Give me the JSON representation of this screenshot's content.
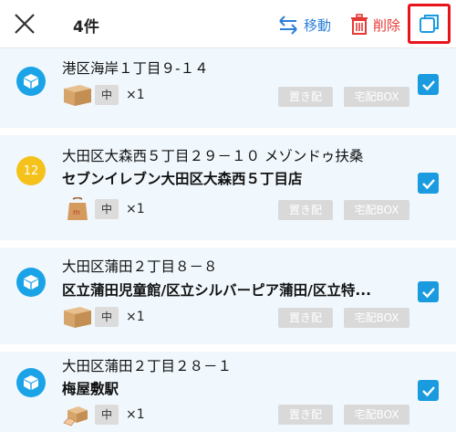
{
  "header": {
    "count_label": "4件",
    "move_label": "移動",
    "delete_label": "削除"
  },
  "items": [
    {
      "address": "港区海岸１丁目９-１４",
      "name": "",
      "size": "中",
      "qty": "×1",
      "marker": "package-icon",
      "okihai": "置き配",
      "box": "宅配BOX",
      "checked": true
    },
    {
      "marker_number": "12",
      "address": "大田区大森西５丁目２９－１０ メゾンドゥ扶桑",
      "name": "セブンイレブン大田区大森西５丁目店",
      "size": "中",
      "qty": "×1",
      "marker": "number-badge",
      "okihai": "置き配",
      "box": "宅配BOX",
      "checked": true
    },
    {
      "address": "大田区蒲田２丁目８－８",
      "name": "区立蒲田児童館/区立シルバーピア蒲田/区立特...",
      "size": "中",
      "qty": "×1",
      "marker": "package-icon",
      "okihai": "置き配",
      "box": "宅配BOX",
      "checked": true
    },
    {
      "address": "大田区蒲田２丁目２８－１",
      "name": "梅屋敷駅",
      "size": "中",
      "qty": "×1",
      "marker": "package-icon",
      "okihai": "置き配",
      "box": "宅配BOX",
      "checked": true
    }
  ],
  "colors": {
    "accent_blue": "#1a9be0",
    "delete_red": "#e53935",
    "highlight_red": "#e8141b",
    "row_bg": "#f1f8fd"
  }
}
